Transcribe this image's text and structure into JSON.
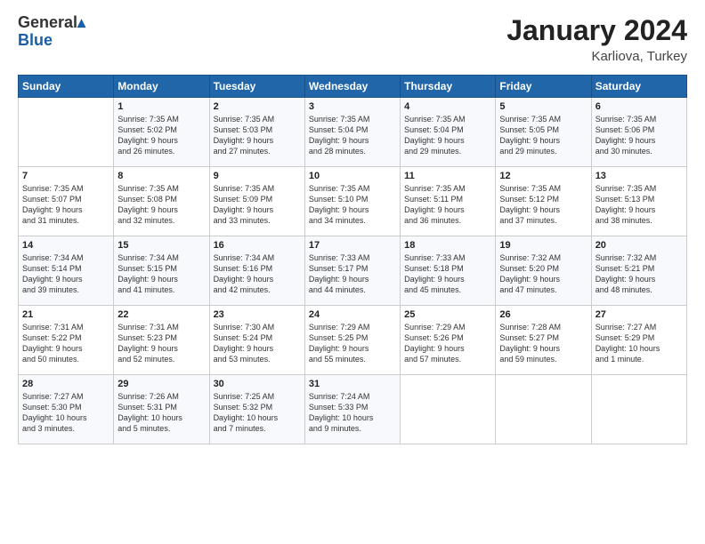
{
  "header": {
    "logo_line1": "General",
    "logo_line2": "Blue",
    "month": "January 2024",
    "location": "Karliova, Turkey"
  },
  "weekdays": [
    "Sunday",
    "Monday",
    "Tuesday",
    "Wednesday",
    "Thursday",
    "Friday",
    "Saturday"
  ],
  "weeks": [
    [
      {
        "day": "",
        "info": ""
      },
      {
        "day": "1",
        "info": "Sunrise: 7:35 AM\nSunset: 5:02 PM\nDaylight: 9 hours\nand 26 minutes."
      },
      {
        "day": "2",
        "info": "Sunrise: 7:35 AM\nSunset: 5:03 PM\nDaylight: 9 hours\nand 27 minutes."
      },
      {
        "day": "3",
        "info": "Sunrise: 7:35 AM\nSunset: 5:04 PM\nDaylight: 9 hours\nand 28 minutes."
      },
      {
        "day": "4",
        "info": "Sunrise: 7:35 AM\nSunset: 5:04 PM\nDaylight: 9 hours\nand 29 minutes."
      },
      {
        "day": "5",
        "info": "Sunrise: 7:35 AM\nSunset: 5:05 PM\nDaylight: 9 hours\nand 29 minutes."
      },
      {
        "day": "6",
        "info": "Sunrise: 7:35 AM\nSunset: 5:06 PM\nDaylight: 9 hours\nand 30 minutes."
      }
    ],
    [
      {
        "day": "7",
        "info": "Sunrise: 7:35 AM\nSunset: 5:07 PM\nDaylight: 9 hours\nand 31 minutes."
      },
      {
        "day": "8",
        "info": "Sunrise: 7:35 AM\nSunset: 5:08 PM\nDaylight: 9 hours\nand 32 minutes."
      },
      {
        "day": "9",
        "info": "Sunrise: 7:35 AM\nSunset: 5:09 PM\nDaylight: 9 hours\nand 33 minutes."
      },
      {
        "day": "10",
        "info": "Sunrise: 7:35 AM\nSunset: 5:10 PM\nDaylight: 9 hours\nand 34 minutes."
      },
      {
        "day": "11",
        "info": "Sunrise: 7:35 AM\nSunset: 5:11 PM\nDaylight: 9 hours\nand 36 minutes."
      },
      {
        "day": "12",
        "info": "Sunrise: 7:35 AM\nSunset: 5:12 PM\nDaylight: 9 hours\nand 37 minutes."
      },
      {
        "day": "13",
        "info": "Sunrise: 7:35 AM\nSunset: 5:13 PM\nDaylight: 9 hours\nand 38 minutes."
      }
    ],
    [
      {
        "day": "14",
        "info": "Sunrise: 7:34 AM\nSunset: 5:14 PM\nDaylight: 9 hours\nand 39 minutes."
      },
      {
        "day": "15",
        "info": "Sunrise: 7:34 AM\nSunset: 5:15 PM\nDaylight: 9 hours\nand 41 minutes."
      },
      {
        "day": "16",
        "info": "Sunrise: 7:34 AM\nSunset: 5:16 PM\nDaylight: 9 hours\nand 42 minutes."
      },
      {
        "day": "17",
        "info": "Sunrise: 7:33 AM\nSunset: 5:17 PM\nDaylight: 9 hours\nand 44 minutes."
      },
      {
        "day": "18",
        "info": "Sunrise: 7:33 AM\nSunset: 5:18 PM\nDaylight: 9 hours\nand 45 minutes."
      },
      {
        "day": "19",
        "info": "Sunrise: 7:32 AM\nSunset: 5:20 PM\nDaylight: 9 hours\nand 47 minutes."
      },
      {
        "day": "20",
        "info": "Sunrise: 7:32 AM\nSunset: 5:21 PM\nDaylight: 9 hours\nand 48 minutes."
      }
    ],
    [
      {
        "day": "21",
        "info": "Sunrise: 7:31 AM\nSunset: 5:22 PM\nDaylight: 9 hours\nand 50 minutes."
      },
      {
        "day": "22",
        "info": "Sunrise: 7:31 AM\nSunset: 5:23 PM\nDaylight: 9 hours\nand 52 minutes."
      },
      {
        "day": "23",
        "info": "Sunrise: 7:30 AM\nSunset: 5:24 PM\nDaylight: 9 hours\nand 53 minutes."
      },
      {
        "day": "24",
        "info": "Sunrise: 7:29 AM\nSunset: 5:25 PM\nDaylight: 9 hours\nand 55 minutes."
      },
      {
        "day": "25",
        "info": "Sunrise: 7:29 AM\nSunset: 5:26 PM\nDaylight: 9 hours\nand 57 minutes."
      },
      {
        "day": "26",
        "info": "Sunrise: 7:28 AM\nSunset: 5:27 PM\nDaylight: 9 hours\nand 59 minutes."
      },
      {
        "day": "27",
        "info": "Sunrise: 7:27 AM\nSunset: 5:29 PM\nDaylight: 10 hours\nand 1 minute."
      }
    ],
    [
      {
        "day": "28",
        "info": "Sunrise: 7:27 AM\nSunset: 5:30 PM\nDaylight: 10 hours\nand 3 minutes."
      },
      {
        "day": "29",
        "info": "Sunrise: 7:26 AM\nSunset: 5:31 PM\nDaylight: 10 hours\nand 5 minutes."
      },
      {
        "day": "30",
        "info": "Sunrise: 7:25 AM\nSunset: 5:32 PM\nDaylight: 10 hours\nand 7 minutes."
      },
      {
        "day": "31",
        "info": "Sunrise: 7:24 AM\nSunset: 5:33 PM\nDaylight: 10 hours\nand 9 minutes."
      },
      {
        "day": "",
        "info": ""
      },
      {
        "day": "",
        "info": ""
      },
      {
        "day": "",
        "info": ""
      }
    ]
  ]
}
